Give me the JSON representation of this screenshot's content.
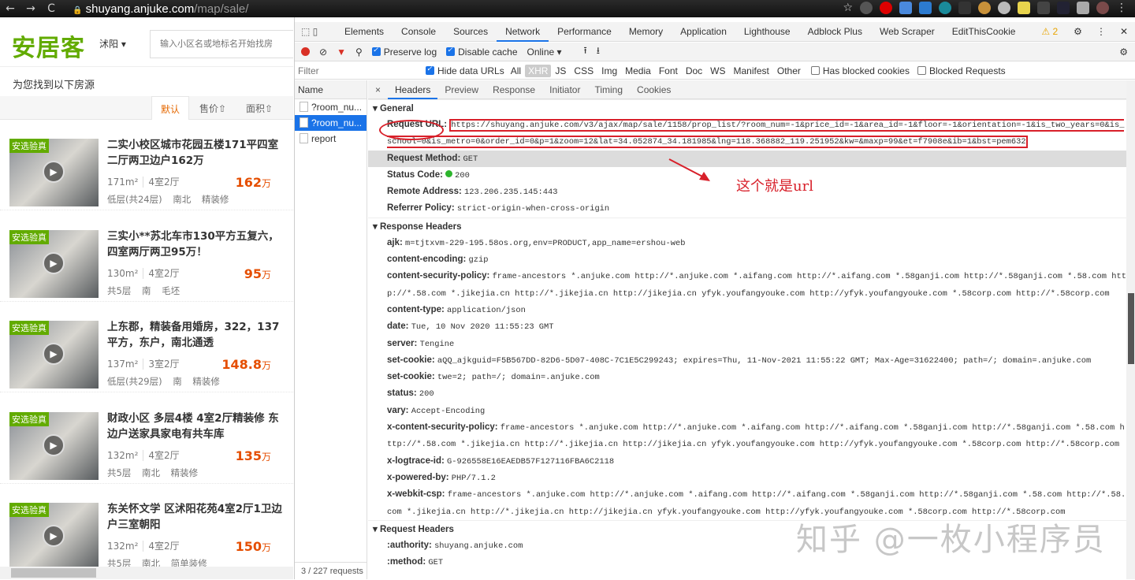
{
  "browser": {
    "url_host": "shuyang.anjuke.com",
    "url_path": "/map/sale/",
    "back": "←",
    "forward": "→",
    "reload": "C",
    "lock": "🔒",
    "star": "☆"
  },
  "site": {
    "logo": "安居客",
    "city": "沭阳 ▾",
    "search_placeholder": "输入小区名或地标名开始找房",
    "found": "为您找到以下房源",
    "sort": [
      "默认",
      "售价⇧",
      "面积⇧"
    ],
    "listings": [
      {
        "badge": "安选验真",
        "title": "二实小校区城市花园五楼171平四室二厅两卫边户162万",
        "area": "171m²",
        "layout": "4室2厅",
        "price": "162",
        "unit": "万",
        "attrs": "低层(共24层) 南北 精装修"
      },
      {
        "badge": "安选验真",
        "title": "三实小**苏北车市130平方五复六，四室两厅两卫95万！",
        "area": "130m²",
        "layout": "4室2厅",
        "price": "95",
        "unit": "万",
        "attrs": "共5层 南 毛坯"
      },
      {
        "badge": "安选验真",
        "title": "上东郡，精装备用婚房，322，137平方，东户，南北通透",
        "area": "137m²",
        "layout": "3室2厅",
        "price": "148.8",
        "unit": "万",
        "attrs": "低层(共29层) 南 精装修"
      },
      {
        "badge": "安选验真",
        "title": "财政小区 多层4楼 4室2厅精装修 东边户送家具家电有共车库",
        "area": "132m²",
        "layout": "4室2厅",
        "price": "135",
        "unit": "万",
        "attrs": "共5层 南北 精装修"
      },
      {
        "badge": "安选验真",
        "title": "东关怀文学 区沭阳花苑4室2厅1卫边户三室朝阳",
        "area": "132m²",
        "layout": "4室2厅",
        "price": "150",
        "unit": "万",
        "attrs": "共5层 南北 简单装修"
      }
    ]
  },
  "devtools": {
    "tabs": [
      "Elements",
      "Console",
      "Sources",
      "Network",
      "Performance",
      "Memory",
      "Application",
      "Lighthouse",
      "Adblock Plus",
      "Web Scraper",
      "EditThisCookie"
    ],
    "warnings": "⚠ 2",
    "preserve_log": "Preserve log",
    "disable_cache": "Disable cache",
    "throttle": "Online",
    "filter_placeholder": "Filter",
    "hide_data_urls": "Hide data URLs",
    "types": [
      "All",
      "XHR",
      "JS",
      "CSS",
      "Img",
      "Media",
      "Font",
      "Doc",
      "WS",
      "Manifest",
      "Other"
    ],
    "has_blocked_cookies": "Has blocked cookies",
    "blocked_requests": "Blocked Requests",
    "name_header": "Name",
    "requests": [
      "?room_nu...",
      "?room_nu...",
      "report"
    ],
    "footer": "3 / 227 requests",
    "detail_tabs": [
      "Headers",
      "Preview",
      "Response",
      "Initiator",
      "Timing",
      "Cookies"
    ],
    "general_title": "General",
    "general": [
      {
        "k": "Request URL:",
        "v": "https://shuyang.anjuke.com/v3/ajax/map/sale/1158/prop_list/?room_num=-1&price_id=-1&area_id=-1&floor=-1&orientation=-1&is_two_years=0&is_school=0&is_metro=0&order_id=0&p=1&zoom=12&lat=34.052874_34.181985&lng=118.368882_119.251952&kw=&maxp=99&et=f7908e&ib=1&bst=pem632"
      },
      {
        "k": "Request Method:",
        "v": "GET"
      },
      {
        "k": "Status Code:",
        "v": "200"
      },
      {
        "k": "Remote Address:",
        "v": "123.206.235.145:443"
      },
      {
        "k": "Referrer Policy:",
        "v": "strict-origin-when-cross-origin"
      }
    ],
    "response_title": "Response Headers",
    "response": [
      {
        "k": "ajk:",
        "v": "m=tjtxvm-229-195.58os.org,env=PRODUCT,app_name=ershou-web"
      },
      {
        "k": "content-encoding:",
        "v": "gzip"
      },
      {
        "k": "content-security-policy:",
        "v": "frame-ancestors *.anjuke.com http://*.anjuke.com *.aifang.com http://*.aifang.com *.58ganji.com http://*.58ganji.com *.58.com http://*.58.com *.jikejia.cn http://*.jikejia.cn http://jikejia.cn yfyk.youfangyouke.com http://yfyk.youfangyouke.com *.58corp.com http://*.58corp.com"
      },
      {
        "k": "content-type:",
        "v": "application/json"
      },
      {
        "k": "date:",
        "v": "Tue, 10 Nov 2020 11:55:23 GMT"
      },
      {
        "k": "server:",
        "v": "Tengine"
      },
      {
        "k": "set-cookie:",
        "v": "aQQ_ajkguid=F5B567DD-82D6-5D07-408C-7C1E5C299243; expires=Thu, 11-Nov-2021 11:55:22 GMT; Max-Age=31622400; path=/; domain=.anjuke.com"
      },
      {
        "k": "set-cookie:",
        "v": "twe=2; path=/; domain=.anjuke.com"
      },
      {
        "k": "status:",
        "v": "200"
      },
      {
        "k": "vary:",
        "v": "Accept-Encoding"
      },
      {
        "k": "x-content-security-policy:",
        "v": "frame-ancestors *.anjuke.com http://*.anjuke.com *.aifang.com http://*.aifang.com *.58ganji.com http://*.58ganji.com *.58.com http://*.58.com *.jikejia.cn http://*.jikejia.cn http://jikejia.cn yfyk.youfangyouke.com http://yfyk.youfangyouke.com *.58corp.com http://*.58corp.com"
      },
      {
        "k": "x-logtrace-id:",
        "v": "G-926558E16EAEDB57F127116FBA6C2118"
      },
      {
        "k": "x-powered-by:",
        "v": "PHP/7.1.2"
      },
      {
        "k": "x-webkit-csp:",
        "v": "frame-ancestors *.anjuke.com http://*.anjuke.com *.aifang.com http://*.aifang.com *.58ganji.com http://*.58ganji.com *.58.com http://*.58.com *.jikejia.cn http://*.jikejia.cn http://jikejia.cn yfyk.youfangyouke.com http://yfyk.youfangyouke.com *.58corp.com http://*.58corp.com"
      }
    ],
    "request_title": "Request Headers",
    "request": [
      {
        "k": ":authority:",
        "v": "shuyang.anjuke.com"
      },
      {
        "k": ":method:",
        "v": "GET"
      }
    ]
  },
  "annotation": "这个就是url",
  "watermark": "知乎 @一枚小程序员",
  "colors": {
    "accent": "#1a73e8",
    "brand": "#62ab00",
    "price": "#e54e00",
    "annotation": "#d8202a"
  }
}
